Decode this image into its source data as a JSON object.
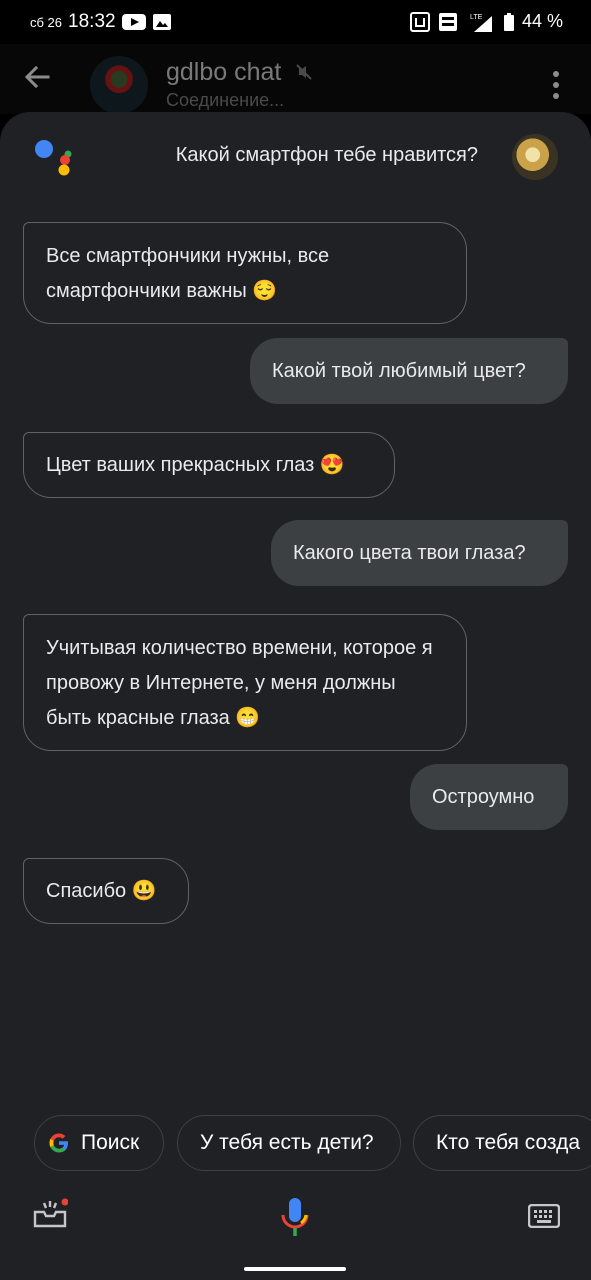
{
  "status_bar": {
    "date": "сб 26",
    "time": "18:32",
    "battery": "44 %",
    "icons": [
      "youtube-icon",
      "image-icon",
      "nfc-icon",
      "volte-icon",
      "signal-icon",
      "battery-icon"
    ]
  },
  "chat_header": {
    "title": "gdlbo chat",
    "subtitle": "Соединение..."
  },
  "assistant": {
    "query": "Какой смартфон тебе нравится?"
  },
  "messages": [
    {
      "role": "assistant",
      "text": "Все смартфончики нужны, все смартфончики важны 😌"
    },
    {
      "role": "user",
      "text": "Какой твой любимый цвет?"
    },
    {
      "role": "assistant",
      "text": "Цвет ваших прекрасных глаз 😍"
    },
    {
      "role": "user",
      "text": "Какого цвета твои глаза?"
    },
    {
      "role": "assistant",
      "text": "Учитывая количество времени, которое я провожу в Интернете, у меня должны быть красные глаза 😁"
    },
    {
      "role": "user",
      "text": "Остроумно"
    },
    {
      "role": "assistant",
      "text": "Спасибо 😃"
    }
  ],
  "suggestions": [
    {
      "label": "Поиск",
      "icon": "google-g-icon"
    },
    {
      "label": "У тебя есть дети?"
    },
    {
      "label": "Кто тебя созда"
    }
  ],
  "colors": {
    "sheet_bg": "#202124",
    "user_bubble": "#3c4043",
    "assistant_border": "#5f6368",
    "google_blue": "#4285F4",
    "google_red": "#EA4335",
    "google_yellow": "#FBBC05",
    "google_green": "#34A853"
  }
}
